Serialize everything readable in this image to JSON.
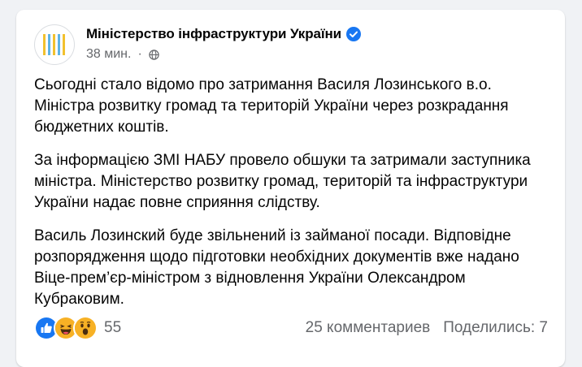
{
  "post": {
    "page_name": "Міністерство інфраструктури України",
    "time": "38 мин.",
    "separator": "·",
    "paragraphs": [
      "Сьогодні стало відомо про затримання Василя Лозинського в.о. Міністра розвитку громад та територій України через розкрадання бюджетних коштів.",
      "За інформацією ЗМІ НАБУ провело обшуки та затримали заступника міністра. Міністерство розвитку громад, територій та інфраструктури України надає повне сприяння слідству.",
      "Василь Лозинский буде звільнений із займаної посади. Відповідне розпорядження щодо підготовки необхідних документів вже надано Віце-прем’єр-міністром з відновлення України Олександром Кубраковим."
    ],
    "reactions": {
      "icons": [
        "like-icon",
        "haha-icon",
        "wow-icon"
      ],
      "count": "55"
    },
    "comments": "25 комментариев",
    "shares": "Поделились: 7"
  },
  "colors": {
    "verified": "#1877f2",
    "like": "#1877f2",
    "emoji": "#f7b125",
    "logo_yellow": "#f2c12e",
    "logo_blue": "#5eb4e6"
  }
}
